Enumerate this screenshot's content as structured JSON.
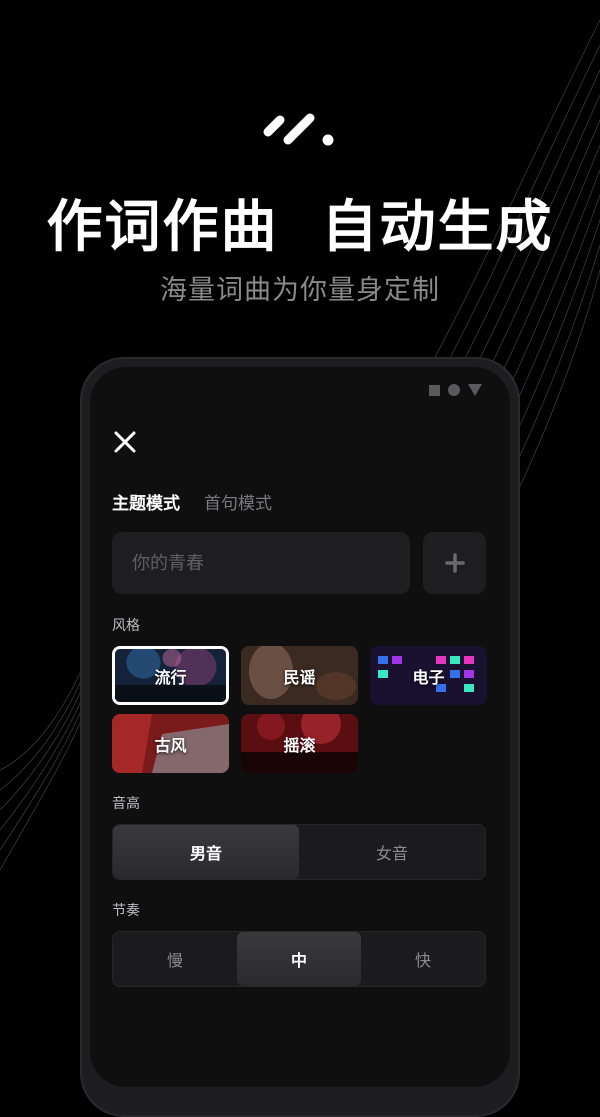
{
  "hero": {
    "headline": "作词作曲  自动生成",
    "subline": "海量词曲为你量身定制"
  },
  "app": {
    "tabs": [
      {
        "label": "主题模式",
        "active": true
      },
      {
        "label": "首句模式",
        "active": false
      }
    ],
    "theme_input": {
      "placeholder": "你的青春",
      "value": ""
    },
    "style": {
      "label": "风格",
      "options": [
        {
          "label": "流行",
          "selected": true
        },
        {
          "label": "民谣",
          "selected": false
        },
        {
          "label": "电子",
          "selected": false
        },
        {
          "label": "古风",
          "selected": false
        },
        {
          "label": "摇滚",
          "selected": false
        }
      ]
    },
    "pitch": {
      "label": "音高",
      "options": [
        {
          "label": "男音",
          "active": true
        },
        {
          "label": "女音",
          "active": false
        }
      ]
    },
    "tempo": {
      "label": "节奏",
      "options": [
        {
          "label": "慢",
          "active": false
        },
        {
          "label": "中",
          "active": true
        },
        {
          "label": "快",
          "active": false
        }
      ]
    }
  },
  "colors": {
    "background": "#000000",
    "panel": "#1e1e20",
    "accent": "#ffffff"
  },
  "icons": [
    "brand-logo-icon",
    "close-icon",
    "plus-icon",
    "status-square-icon",
    "status-circle-icon",
    "status-triangle-icon"
  ]
}
